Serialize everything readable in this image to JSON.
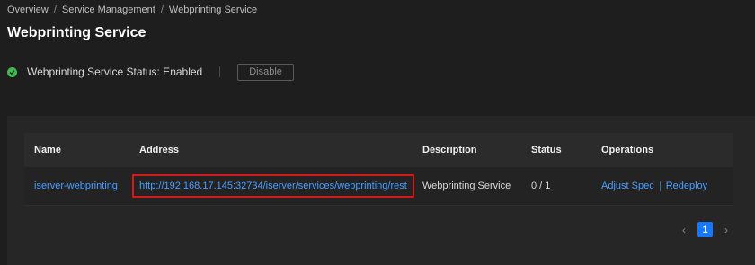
{
  "breadcrumb": {
    "items": [
      "Overview",
      "Service Management",
      "Webprinting Service"
    ],
    "separator": "/"
  },
  "page": {
    "title": "Webprinting Service"
  },
  "status": {
    "label": "Webprinting Service Status: Enabled",
    "icon": "check-circle-icon",
    "color": "#3fb950",
    "disable_label": "Disable"
  },
  "table": {
    "columns": [
      "Name",
      "Address",
      "Description",
      "Status",
      "Operations"
    ],
    "rows": [
      {
        "name": "iserver-webprinting",
        "address": "http://192.168.17.145:32734/iserver/services/webprinting/rest",
        "description": "Webprinting Service",
        "status": "0 / 1",
        "operations": [
          "Adjust Spec",
          "Redeploy"
        ]
      }
    ]
  },
  "pagination": {
    "current": "1",
    "prev_icon": "chevron-left-icon",
    "next_icon": "chevron-right-icon"
  },
  "colors": {
    "accent": "#1677ff",
    "link": "#4a9eff",
    "highlight": "#d11a1a"
  }
}
